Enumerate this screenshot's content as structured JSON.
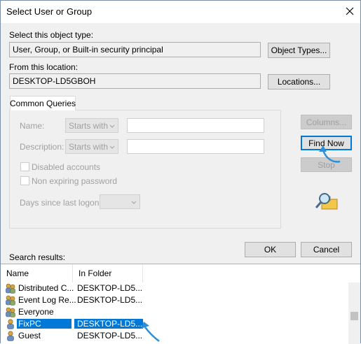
{
  "window": {
    "title": "Select User or Group"
  },
  "object_type": {
    "label": "Select this object type:",
    "value": "User, Group, or Built-in security principal",
    "button": "Object Types..."
  },
  "location": {
    "label": "From this location:",
    "value": "DESKTOP-LD5GBOH",
    "button": "Locations..."
  },
  "tab": {
    "label": "Common Queries"
  },
  "queries": {
    "name_label": "Name:",
    "name_mode": "Starts with",
    "description_label": "Description:",
    "description_mode": "Starts with",
    "disabled_accounts": "Disabled accounts",
    "non_expiring_password": "Non expiring password",
    "days_since_logon_label": "Days since last logon:"
  },
  "side_buttons": {
    "columns": "Columns...",
    "find_now": "Find Now",
    "stop": "Stop"
  },
  "footer": {
    "search_results_label": "Search results:",
    "ok": "OK",
    "cancel": "Cancel"
  },
  "results": {
    "columns": [
      "Name",
      "In Folder"
    ],
    "rows": [
      {
        "name": "Distributed C...",
        "folder": "DESKTOP-LD5...",
        "icon": "group-icon",
        "selected": false
      },
      {
        "name": "Event Log Re...",
        "folder": "DESKTOP-LD5...",
        "icon": "group-icon",
        "selected": false
      },
      {
        "name": "Everyone",
        "folder": "",
        "icon": "group-icon",
        "selected": false
      },
      {
        "name": "FixPC",
        "folder": "DESKTOP-LD5...",
        "icon": "user-icon",
        "selected": true
      },
      {
        "name": "Guest",
        "folder": "DESKTOP-LD5...",
        "icon": "user-icon",
        "selected": false
      }
    ]
  },
  "colors": {
    "accent": "#0078d7",
    "annotation_arrow": "#2d8fd5"
  }
}
